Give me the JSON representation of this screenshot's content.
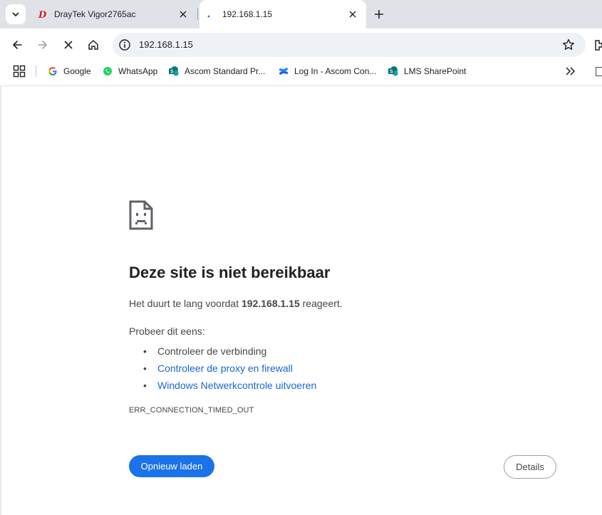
{
  "tabs": [
    {
      "title": "DrayTek Vigor2765ac",
      "favicon": "draytek-logo-icon",
      "active": false
    },
    {
      "title": "192.168.1.15",
      "favicon": "loading-spinner-icon",
      "active": true
    }
  ],
  "toolbar": {
    "url": "192.168.1.15"
  },
  "bookmarks": [
    {
      "label": "Google",
      "icon": "google-icon"
    },
    {
      "label": "WhatsApp",
      "icon": "whatsapp-icon"
    },
    {
      "label": "Ascom Standard Pr...",
      "icon": "sharepoint-icon"
    },
    {
      "label": "Log In - Ascom Con...",
      "icon": "confluence-icon"
    },
    {
      "label": "LMS SharePoint",
      "icon": "sharepoint-icon"
    }
  ],
  "error_page": {
    "heading": "Deze site is niet bereikbaar",
    "message_prefix": "Het duurt te lang voordat ",
    "message_host": "192.168.1.15",
    "message_suffix": " reageert.",
    "try_label": "Probeer dit eens:",
    "suggestions": [
      {
        "text": "Controleer de verbinding",
        "link": false
      },
      {
        "text": "Controleer de proxy en firewall",
        "link": true
      },
      {
        "text": "Windows Netwerkcontrole uitvoeren",
        "link": true
      }
    ],
    "error_code": "ERR_CONNECTION_TIMED_OUT",
    "reload_label": "Opnieuw laden",
    "details_label": "Details"
  },
  "colors": {
    "accent": "#1a73e8",
    "link": "#1967d2",
    "tabstrip": "#dfe3e8"
  }
}
